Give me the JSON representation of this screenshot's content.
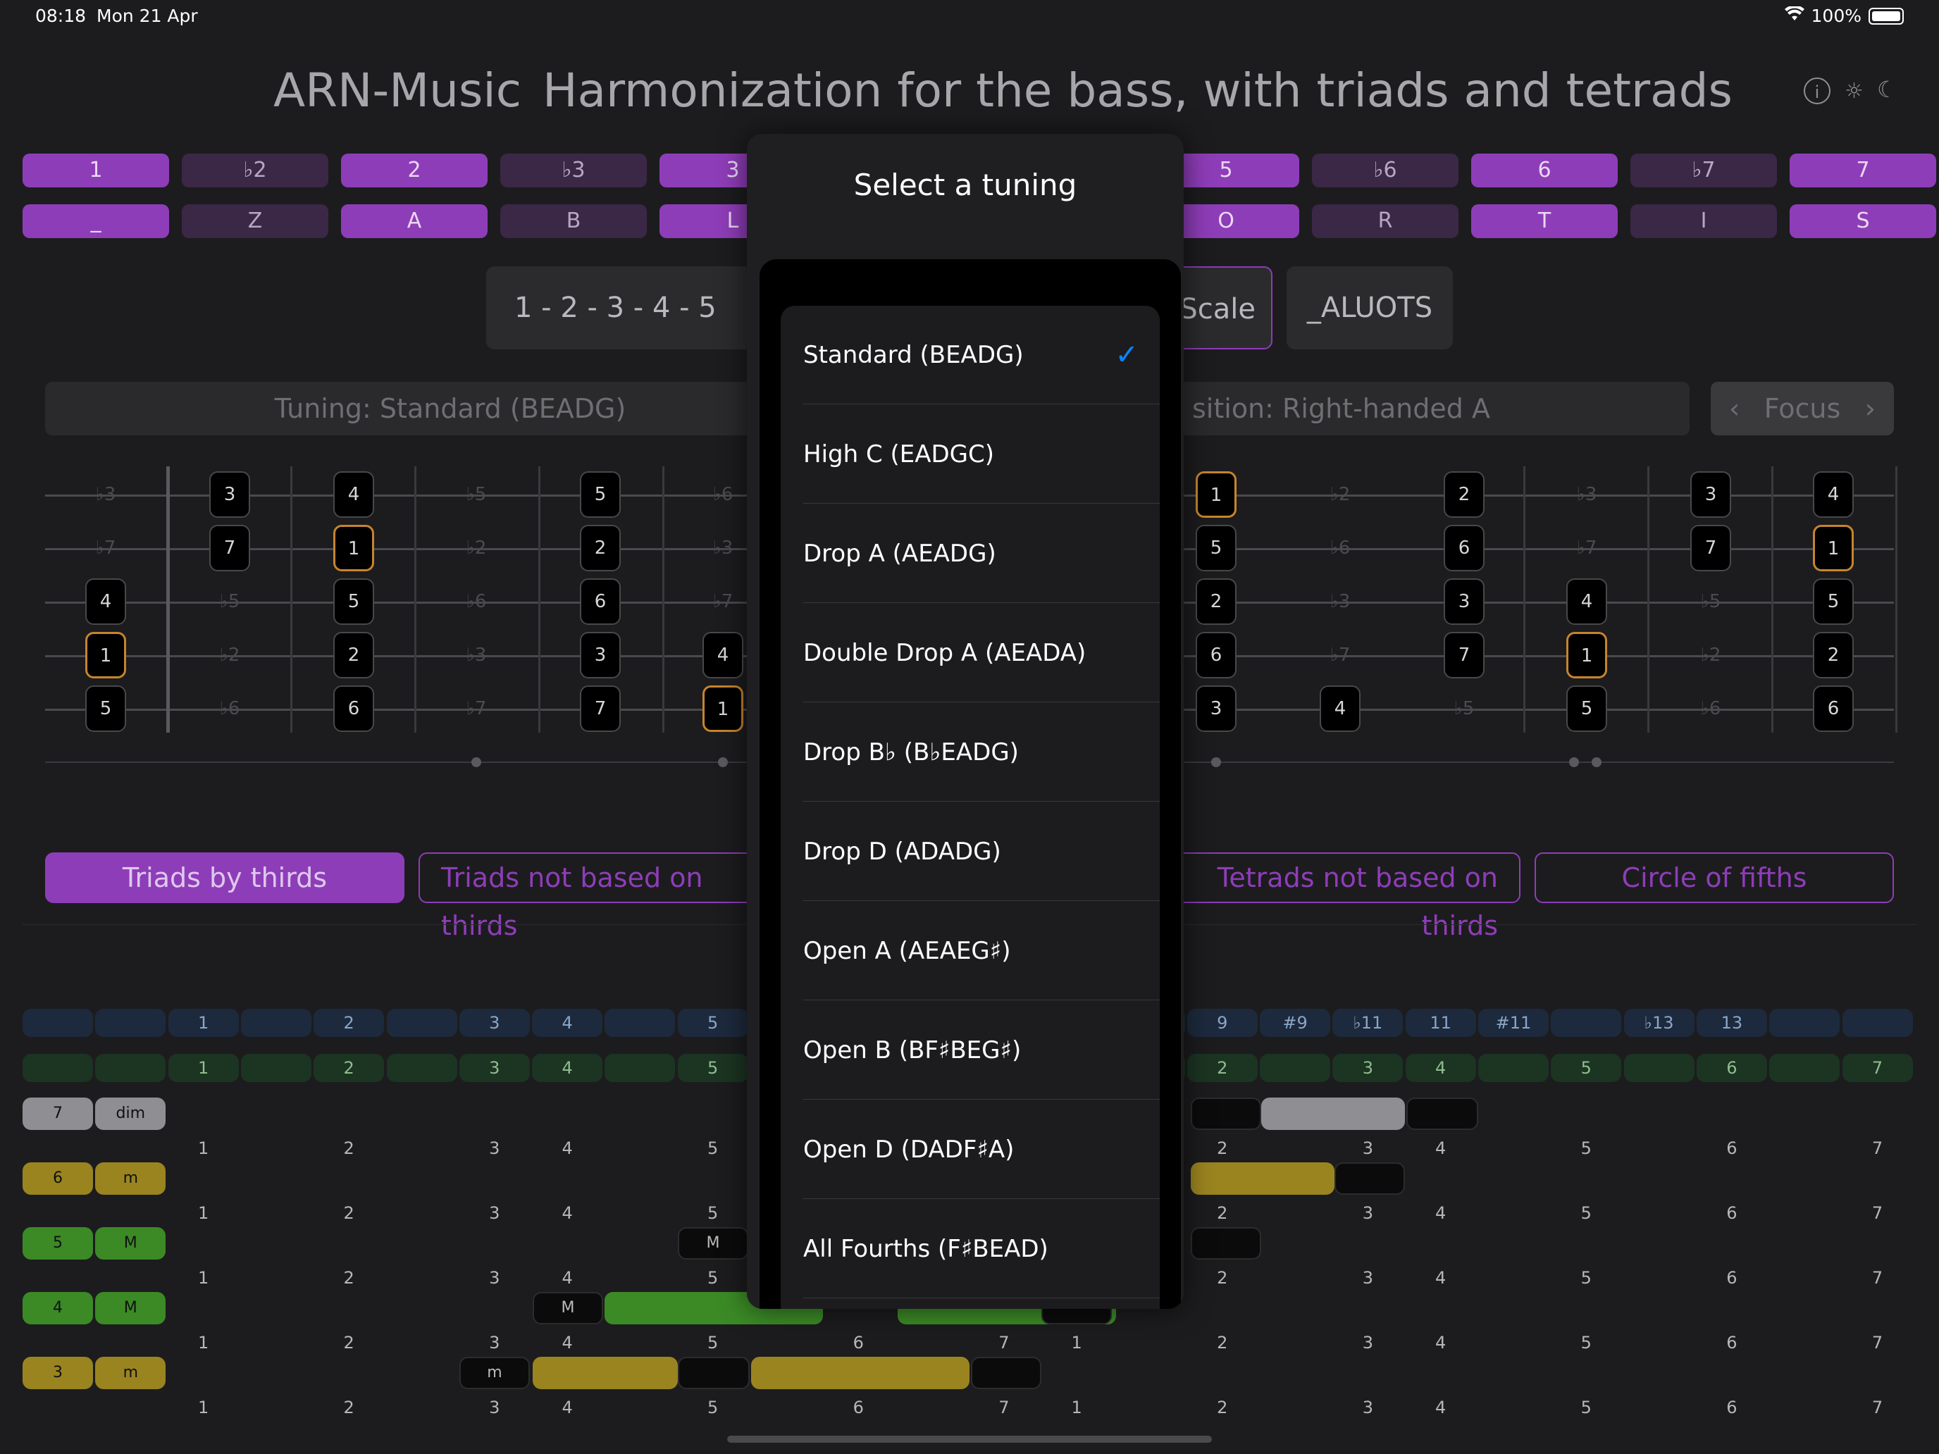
{
  "status": {
    "time": "08:18",
    "date": "Mon 21 Apr",
    "battery": "100%"
  },
  "header": {
    "app": "ARN-Music",
    "subtitle": "Harmonization for the bass, with triads and tetrads"
  },
  "intervals": [
    {
      "label": "1",
      "on": true
    },
    {
      "label": "♭2",
      "on": false
    },
    {
      "label": "2",
      "on": true
    },
    {
      "label": "♭3",
      "on": false
    },
    {
      "label": "3",
      "on": true
    },
    {
      "label": "5",
      "on": true
    },
    {
      "label": "♭6",
      "on": false
    },
    {
      "label": "6",
      "on": true
    },
    {
      "label": "♭7",
      "on": false
    },
    {
      "label": "7",
      "on": true
    }
  ],
  "letters": [
    {
      "label": "_",
      "on": true
    },
    {
      "label": "Z",
      "on": false
    },
    {
      "label": "A",
      "on": true
    },
    {
      "label": "B",
      "on": false
    },
    {
      "label": "L",
      "on": true
    },
    {
      "label": "O",
      "on": true
    },
    {
      "label": "R",
      "on": false
    },
    {
      "label": "T",
      "on": true
    },
    {
      "label": "I",
      "on": false
    },
    {
      "label": "S",
      "on": true
    }
  ],
  "scale": {
    "formula": "1 - 2 - 3 - 4 - 5",
    "scale_btn": "Scale",
    "name_btn": "_ALUOTS"
  },
  "tuning_bar": {
    "tuning": "Tuning: Standard (BEADG)",
    "position": "sition: Right-handed A",
    "focus": "Focus"
  },
  "fretboard": {
    "strings": [
      {
        "notes": [
          "♭3",
          "3",
          "4",
          "♭5",
          "5",
          "♭6",
          "",
          "1",
          "♭2",
          "2",
          "♭3",
          "3",
          "4"
        ]
      },
      {
        "notes": [
          "♭7",
          "7",
          "1",
          "♭2",
          "2",
          "♭3",
          "",
          "5",
          "♭6",
          "6",
          "♭7",
          "7",
          "1"
        ]
      },
      {
        "notes": [
          "4",
          "♭5",
          "5",
          "♭6",
          "6",
          "♭7",
          "",
          "2",
          "♭3",
          "3",
          "4",
          "♭5",
          "5"
        ]
      },
      {
        "notes": [
          "1",
          "♭2",
          "2",
          "♭3",
          "3",
          "4",
          "",
          "6",
          "♭7",
          "7",
          "1",
          "♭2",
          "2"
        ]
      },
      {
        "notes": [
          "5",
          "♭6",
          "6",
          "♭7",
          "7",
          "1",
          "",
          "3",
          "4",
          "♭5",
          "5",
          "♭6",
          "6"
        ]
      }
    ]
  },
  "tabs": [
    "Triads by thirds",
    "Triads not based on thirds",
    "Tetrads not based on thirds",
    "Circle of fifths"
  ],
  "grid": {
    "blue_labels": [
      "",
      "",
      "1",
      "",
      "2",
      "",
      "3",
      "4",
      "",
      "5",
      "",
      "",
      "",
      "",
      "",
      "",
      "9",
      "#9",
      "♭11",
      "11",
      "#11",
      "",
      "♭13",
      "13",
      "",
      ""
    ],
    "green_labels": [
      "",
      "",
      "1",
      "",
      "2",
      "",
      "3",
      "4",
      "",
      "5",
      "",
      "",
      "",
      "",
      "",
      "",
      "2",
      "",
      "3",
      "4",
      "",
      "5",
      "",
      "6",
      "",
      "7"
    ],
    "rows": [
      {
        "degree": "7",
        "quality": "dim",
        "color": "#8e8e93"
      },
      {
        "degree": "6",
        "quality": "m",
        "color": "#9a8420"
      },
      {
        "degree": "5",
        "quality": "M",
        "color": "#3b8a26"
      },
      {
        "degree": "4",
        "quality": "M",
        "color": "#3b8a26"
      },
      {
        "degree": "3",
        "quality": "m",
        "color": "#9a8420"
      }
    ],
    "row_numbers_left": [
      "1",
      "2",
      "3",
      "4",
      "5"
    ],
    "row_numbers_right": [
      "2",
      "3",
      "4",
      "5",
      "6",
      "7"
    ],
    "last_row_numbers": [
      "1",
      "2",
      "3",
      "4",
      "5",
      "6",
      "7",
      "1",
      "2",
      "3",
      "4",
      "5",
      "6",
      "7"
    ],
    "chord_marks": {
      "m": "m",
      "M": "M"
    }
  },
  "popover": {
    "title": "Select a tuning",
    "options": [
      {
        "label": "Standard (BEADG)",
        "selected": true
      },
      {
        "label": "High C (EADGC)",
        "selected": false
      },
      {
        "label": "Drop A (AEADG)",
        "selected": false
      },
      {
        "label": "Double Drop A (AEADA)",
        "selected": false
      },
      {
        "label": "Drop B♭ (B♭EADG)",
        "selected": false
      },
      {
        "label": "Drop D (ADADG)",
        "selected": false
      },
      {
        "label": "Open A (AEAEG♯)",
        "selected": false
      },
      {
        "label": "Open B (BF♯BEG♯)",
        "selected": false
      },
      {
        "label": "Open D (DADF♯A)",
        "selected": false
      },
      {
        "label": "All Fourths (F♯BEAD)",
        "selected": false
      }
    ],
    "check": "✓"
  },
  "icons": {
    "info": "info-icon",
    "sun": "sun-icon",
    "moon": "moon-icon",
    "chev_left": "‹",
    "chev_right": "›"
  }
}
